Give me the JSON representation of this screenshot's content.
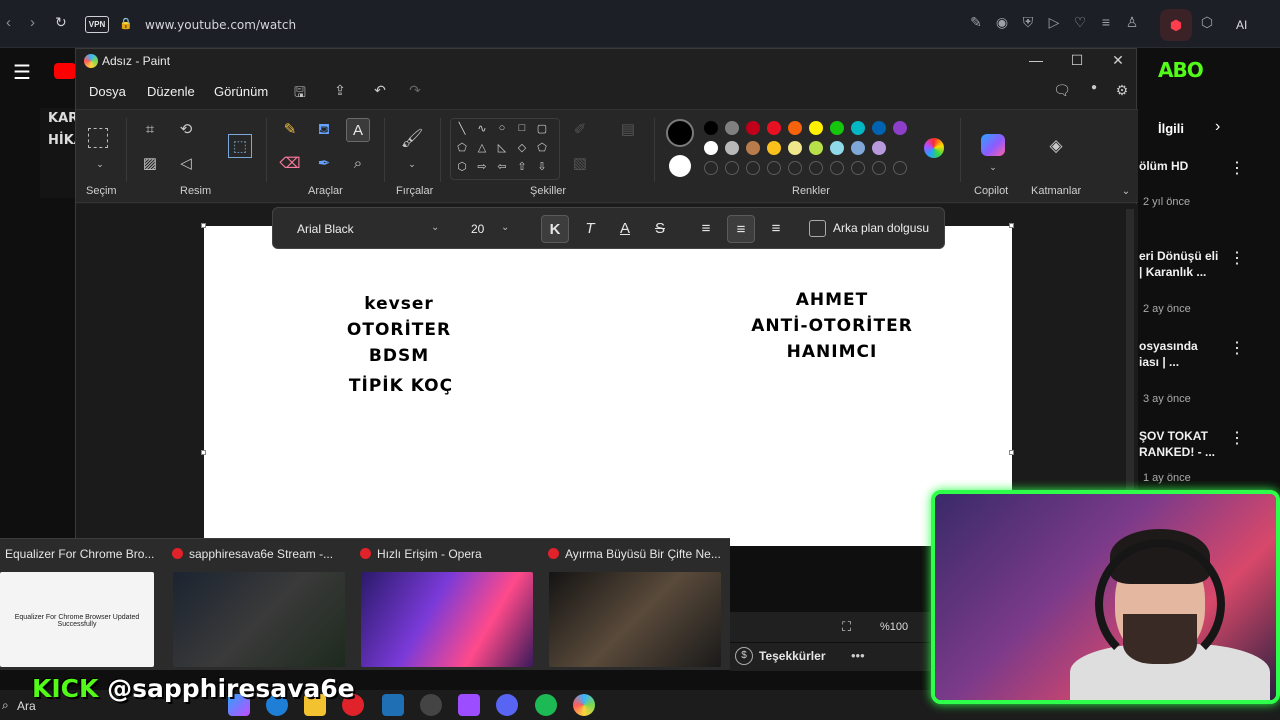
{
  "browser": {
    "vpn": "VPN",
    "url": "www.youtube.com/watch",
    "ai_label": "AI"
  },
  "youtube": {
    "thumb_text": "KAR HİKA",
    "related_label": "İlgili",
    "related": [
      {
        "title": "ölüm HD",
        "meta": "2 yıl önce"
      },
      {
        "title": "eri Dönüşü eli | Karanlık ...",
        "meta": "2 ay önce"
      },
      {
        "title": "osyasında iası | ...",
        "meta": "3 ay önce"
      },
      {
        "title": "ŞOV TOKAT RANKED! - ...",
        "meta": "1 ay önce"
      }
    ]
  },
  "paint": {
    "window_title": "Adsız - Paint",
    "menu": [
      "Dosya",
      "Düzenle",
      "Görünüm"
    ],
    "groups": {
      "selection": "Seçim",
      "image": "Resim",
      "tools": "Araçlar",
      "brushes": "Fırçalar",
      "shapes": "Şekiller",
      "colors": "Renkler",
      "copilot": "Copilot",
      "layers": "Katmanlar"
    },
    "palette_row1": [
      "#000000",
      "#7f7f7f",
      "#c0001b",
      "#e81123",
      "#f7630c",
      "#fff100",
      "#16c60c",
      "#00b7c3",
      "#0063b1",
      "#8e3fc9"
    ],
    "palette_row2": [
      "#ffffff",
      "#b9b9b9",
      "#b87c4c",
      "#fcc21b",
      "#f0e68c",
      "#b8e04a",
      "#8fd9e8",
      "#7fa7d8",
      "#b79adb"
    ],
    "text_toolbar": {
      "font": "Arial Black",
      "size": "20",
      "bg_fill_label": "Arka plan dolgusu"
    },
    "canvas_text": {
      "left": [
        "kevser",
        "OTORİTER",
        "BDSM",
        "TİPİK KOÇ"
      ],
      "right": [
        "AHMET",
        "ANTİ-OTORİTER",
        "HANIMCI"
      ]
    },
    "zoom": "%100"
  },
  "taskbar_previews": [
    {
      "title": "Equalizer For Chrome Bro...",
      "thumb_text": "Equalizer For Chrome Browser Updated Successfully"
    },
    {
      "title": "sapphiresava6e Stream -..."
    },
    {
      "title": "Hızlı Erişim - Opera"
    },
    {
      "title": "Ayırma Büyüsü Bir Çifte Ne..."
    }
  ],
  "overlay": {
    "kick_word": "KICK",
    "handle": "@sapphiresava6e",
    "thanks": "Teşekkürler"
  },
  "taskbar": {
    "search_label": "Ara"
  }
}
